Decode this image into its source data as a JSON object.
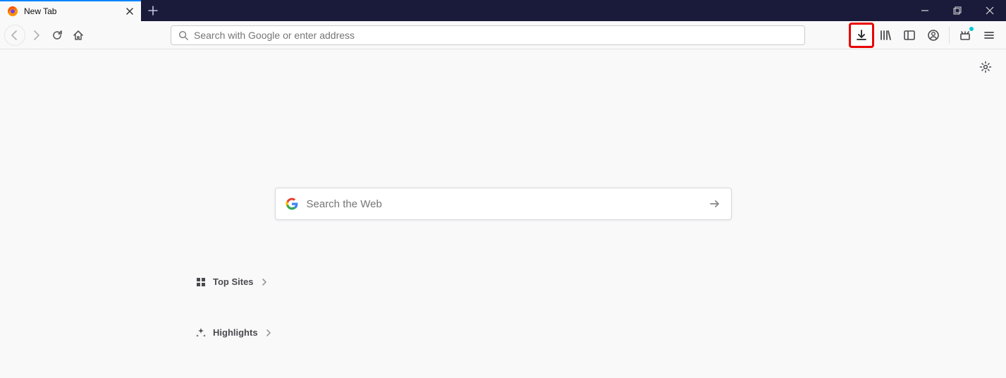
{
  "tab": {
    "title": "New Tab"
  },
  "urlbar": {
    "placeholder": "Search with Google or enter address"
  },
  "content": {
    "search_placeholder": "Search the Web",
    "sections": {
      "top_sites": "Top Sites",
      "highlights": "Highlights"
    }
  }
}
